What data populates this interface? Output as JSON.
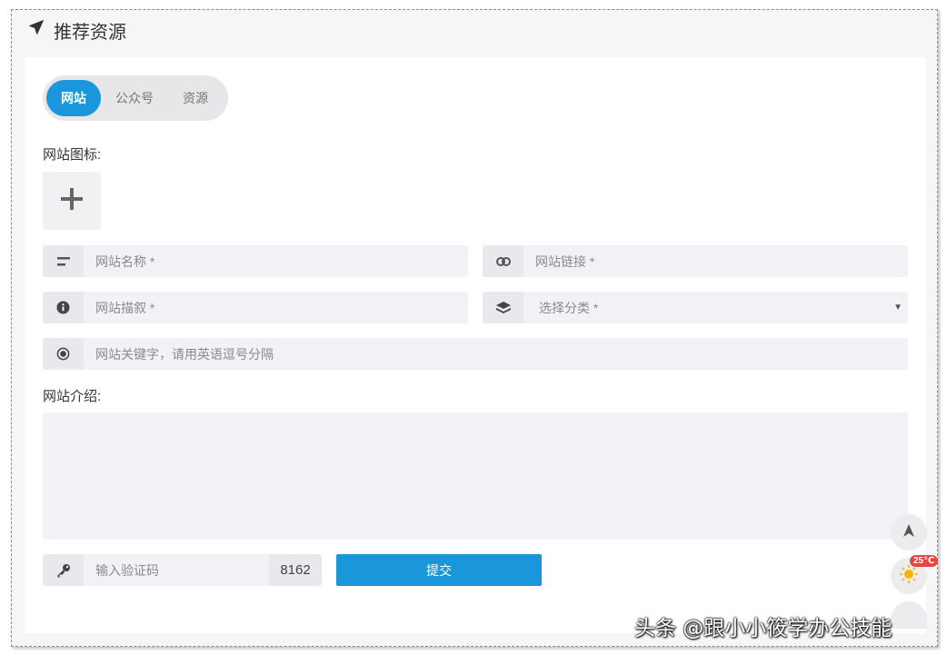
{
  "header": {
    "title": "推荐资源",
    "icon": "paper-plane-icon"
  },
  "tabs": [
    {
      "label": "网站",
      "active": true
    },
    {
      "label": "公众号",
      "active": false
    },
    {
      "label": "资源",
      "active": false
    }
  ],
  "form": {
    "icon_label": "网站图标:",
    "name_placeholder": "网站名称 *",
    "link_placeholder": "网站链接 *",
    "desc_placeholder": "网站描叙 *",
    "category_placeholder": "选择分类 *",
    "keywords_placeholder": "网站关键字，请用英语逗号分隔",
    "intro_label": "网站介绍:",
    "captcha_placeholder": "输入验证码",
    "captcha_value": "8162",
    "submit_label": "提交"
  },
  "floating": {
    "temperature": "25℃"
  },
  "watermark": "头条 @跟小小筱学办公技能",
  "colors": {
    "accent": "#1a96db",
    "badge": "#e8453c"
  }
}
